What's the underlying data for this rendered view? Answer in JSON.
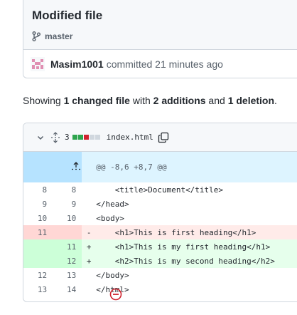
{
  "commit": {
    "title": "Modified file",
    "branch": "master",
    "author": "Masim1001",
    "action": "committed 21 minutes ago"
  },
  "summary": {
    "prefix": "Showing ",
    "changed": "1 changed file",
    "mid1": " with ",
    "additions": "2 additions",
    "mid2": " and ",
    "deletions": "1 deletion",
    "suffix": "."
  },
  "file": {
    "changes": "3",
    "filename": "index.html",
    "diffstat": [
      "add",
      "add",
      "del",
      "neutral",
      "neutral"
    ],
    "hunk_header": "@@ -8,6 +8,7 @@",
    "lines": [
      {
        "type": "ctx",
        "old": "8",
        "new": "8",
        "sign": "",
        "code": "    <title>Document</title>"
      },
      {
        "type": "ctx",
        "old": "9",
        "new": "9",
        "sign": "",
        "code": "</head>"
      },
      {
        "type": "ctx",
        "old": "10",
        "new": "10",
        "sign": "",
        "code": "<body>"
      },
      {
        "type": "del",
        "old": "11",
        "new": "",
        "sign": "-",
        "code": "    <h1>This is first heading</h1>"
      },
      {
        "type": "add",
        "old": "",
        "new": "11",
        "sign": "+",
        "code": "    <h1>This is my first heading</h1>"
      },
      {
        "type": "add",
        "old": "",
        "new": "12",
        "sign": "+",
        "code": "    <h2>This is my second heading</h2>"
      },
      {
        "type": "ctx",
        "old": "12",
        "new": "13",
        "sign": "",
        "code": "</body>"
      },
      {
        "type": "ctx",
        "old": "13",
        "new": "14",
        "sign": "",
        "code": "</html>"
      }
    ]
  },
  "colors": {
    "add": "#2da44e",
    "del": "#cf222e",
    "neutral": "#d0d7de",
    "no_newline_icon": "#cf222e"
  },
  "icons": {
    "branch": "git-branch-icon",
    "avatar": "identicon-avatar",
    "collapse": "chevron-down-icon",
    "expand": "expand-lines-icon",
    "copy": "copy-icon",
    "expand_up": "expand-up-icon",
    "no_newline": "no-newline-icon"
  }
}
